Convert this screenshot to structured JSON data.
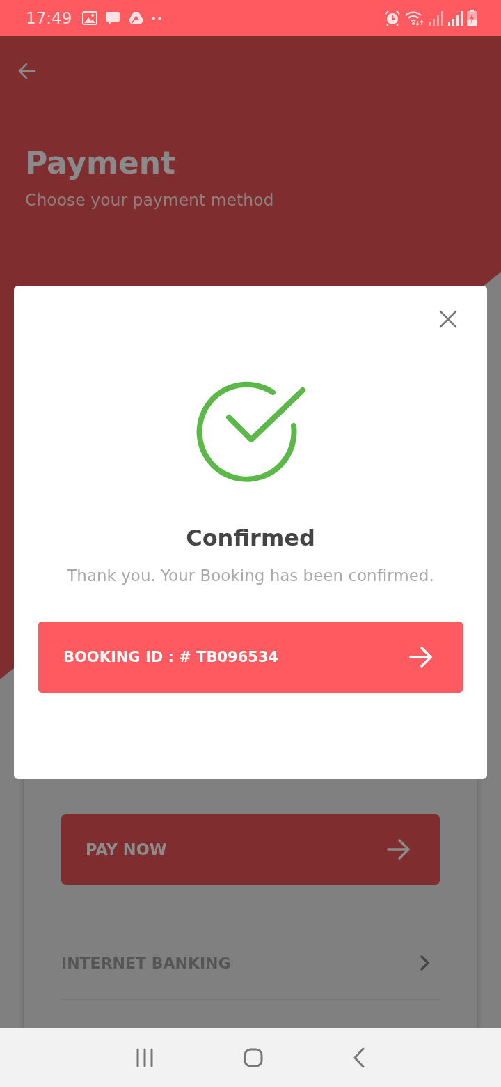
{
  "status_bar": {
    "time": "17:49"
  },
  "screen": {
    "title": "Payment",
    "subtitle": "Choose your payment method"
  },
  "payment_card": {
    "pay_button": "PAY NOW",
    "methods": [
      {
        "label": "INTERNET BANKING"
      }
    ]
  },
  "dialog": {
    "title": "Confirmed",
    "message": "Thank you. Your Booking has been confirmed.",
    "button": "BOOKING ID : # TB096534"
  }
}
